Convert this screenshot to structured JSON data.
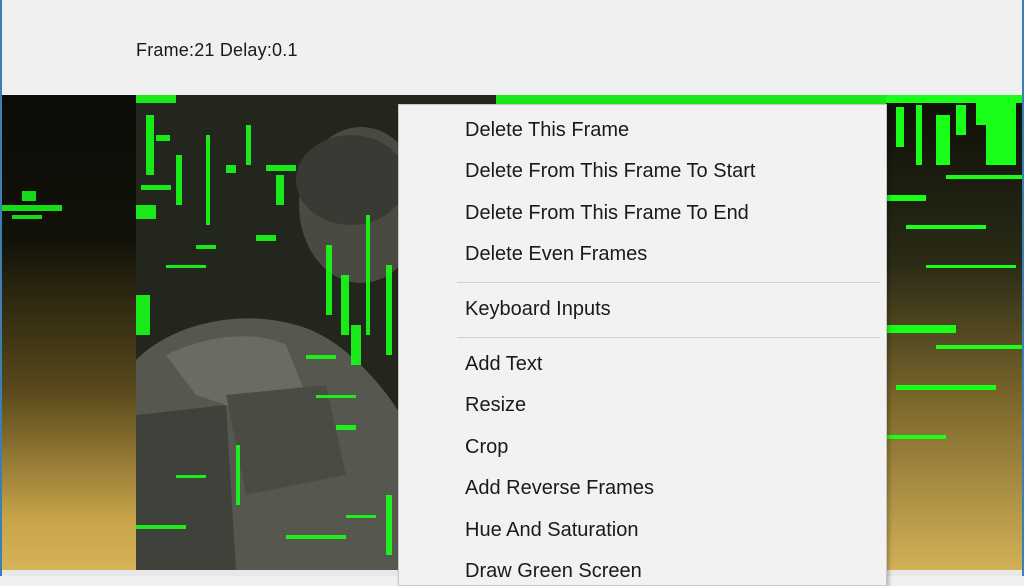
{
  "info_bar": {
    "frame_info": "Frame:21 Delay:0.1"
  },
  "context_menu": {
    "groups": [
      [
        "Delete This Frame",
        "Delete From This Frame To Start",
        "Delete From This Frame To End",
        "Delete Even Frames"
      ],
      [
        "Keyboard Inputs"
      ],
      [
        "Add Text",
        "Resize",
        "Crop",
        "Add Reverse Frames",
        "Hue And Saturation",
        "Draw Green Screen"
      ]
    ],
    "items": {
      "delete_this_frame": "Delete This Frame",
      "delete_to_start": "Delete From This Frame To Start",
      "delete_to_end": "Delete From This Frame To End",
      "delete_even_frames": "Delete Even Frames",
      "keyboard_inputs": "Keyboard Inputs",
      "add_text": "Add Text",
      "resize": "Resize",
      "crop": "Crop",
      "add_reverse_frames": "Add Reverse Frames",
      "hue_and_saturation": "Hue And Saturation",
      "draw_green_screen": "Draw Green Screen"
    }
  },
  "colors": {
    "window_border": "#3c7fb1",
    "menu_background": "#f2f2f2",
    "green_screen": "#19ff19"
  }
}
